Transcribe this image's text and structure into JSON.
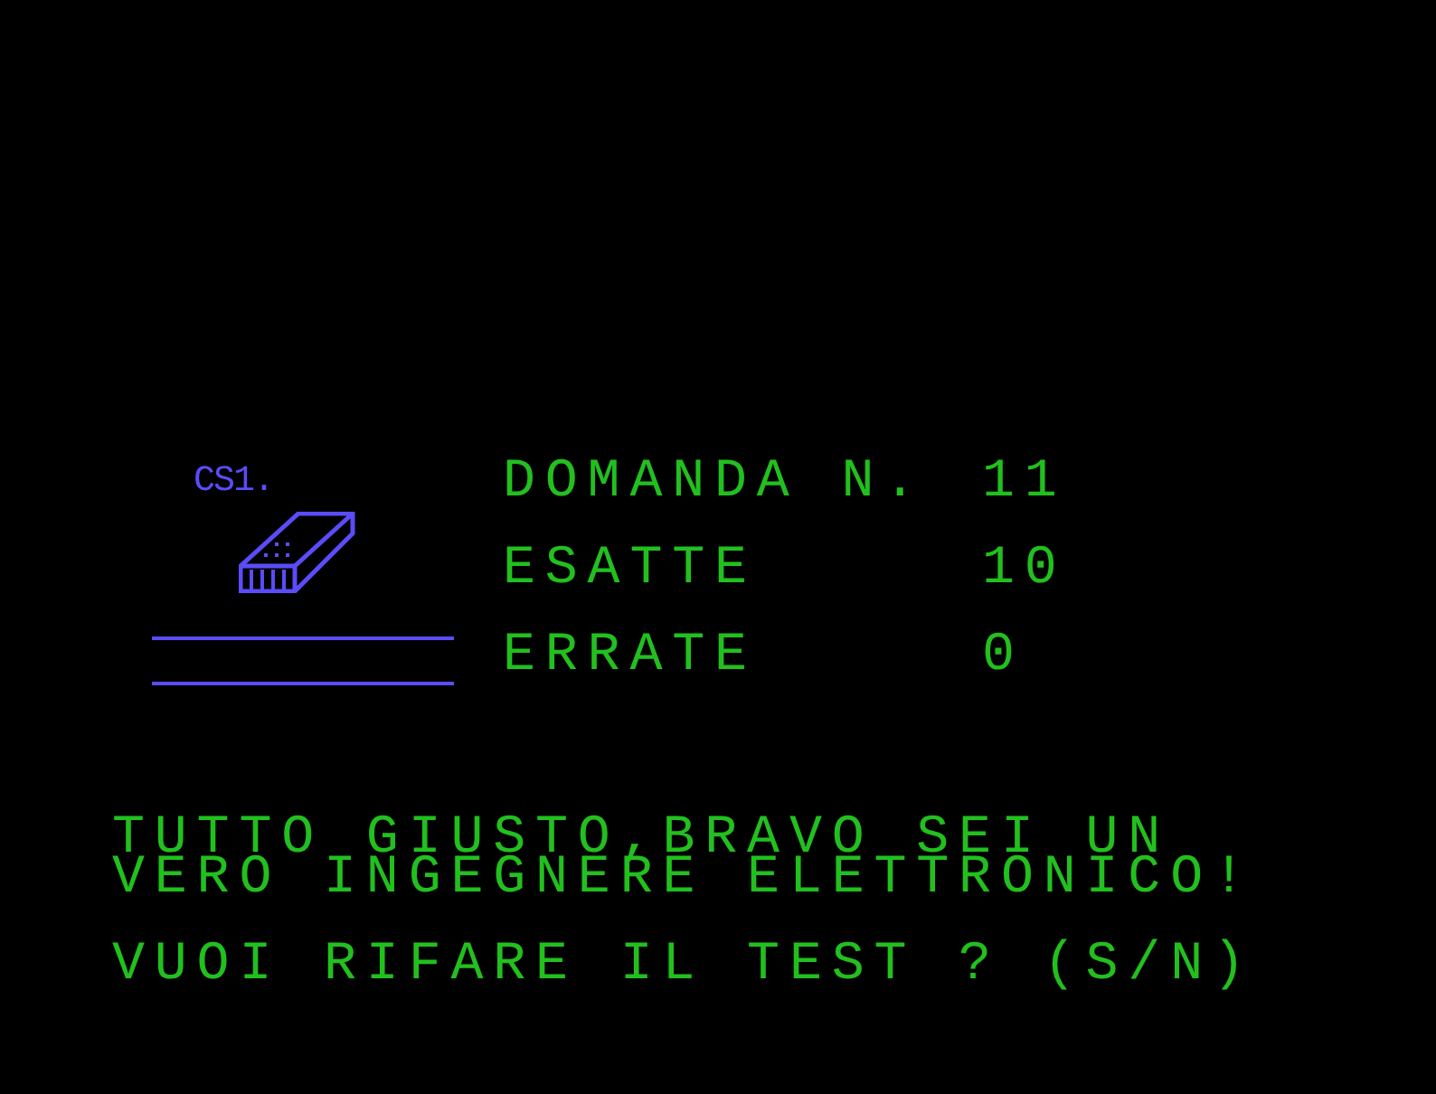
{
  "logo": {
    "text": "CS1."
  },
  "stats": [
    {
      "label": "DOMANDA N.",
      "value": "11"
    },
    {
      "label": "ESATTE",
      "value": "10"
    },
    {
      "label": "ERRATE",
      "value": "0"
    }
  ],
  "message_lines": [
    "TUTTO GIUSTO,BRAVO SEI UN",
    "VERO INGEGNERE ELETTRONICO!"
  ],
  "prompt": "VUOI RIFARE IL TEST ? (S/N)"
}
